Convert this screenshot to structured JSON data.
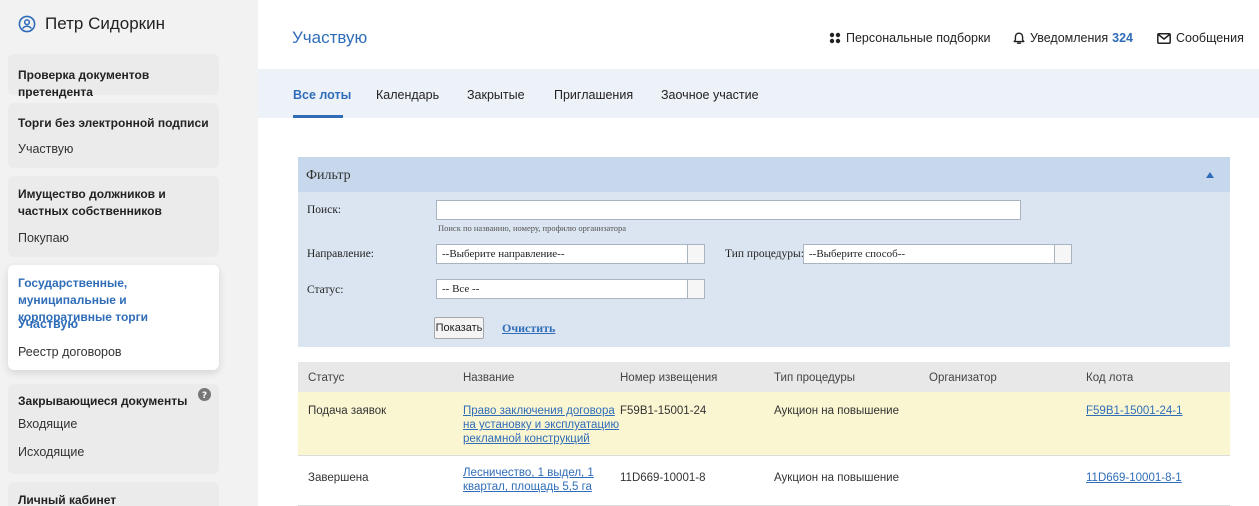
{
  "user": {
    "name": "Петр Сидоркин"
  },
  "sidebar": {
    "sections": [
      {
        "title": "Проверка документов претендента",
        "items": []
      },
      {
        "title": "Торги без электронной подписи",
        "items": [
          "Участвую"
        ]
      },
      {
        "title": "Имущество должников и частных собственников",
        "items": [
          "Покупаю"
        ]
      },
      {
        "title": "Государственные, муниципальные и корпоративные торги",
        "items": [
          "Участвую",
          "Реестр договоров"
        ],
        "active": true,
        "selected_item": "Участвую"
      },
      {
        "title": "Закрывающиеся документы",
        "items": [
          "Входящие",
          "Исходящие"
        ],
        "help_icon": "question-circle-icon"
      },
      {
        "title": "Личный кабинет",
        "items": []
      }
    ]
  },
  "header": {
    "title": "Участвую",
    "links": {
      "personal": "Персональные подборки",
      "notifications": "Уведомления",
      "notifications_count": "324",
      "messages": "Сообщения"
    }
  },
  "tabs": [
    "Все лоты",
    "Календарь",
    "Закрытые",
    "Приглашения",
    "Заочное участие"
  ],
  "active_tab": "Все лоты",
  "filter": {
    "title": "Фильтр",
    "search_label": "Поиск:",
    "search_value": "",
    "search_hint": "Поиск по названию, номеру, профилю организатора",
    "direction_label": "Направление:",
    "direction_value": "--Выберите направление--",
    "procedure_label": "Тип процедуры:",
    "procedure_value": "--Выберите способ--",
    "status_label": "Статус:",
    "status_value": "-- Все --",
    "show_button": "Показать",
    "clear_button": "Очистить"
  },
  "table": {
    "columns": [
      "Статус",
      "Название",
      "Номер извещения",
      "Тип процедуры",
      "Организатор",
      "Код лота"
    ],
    "rows": [
      {
        "status": "Подача заявок",
        "name_lines": [
          "Право заключения договора",
          "на установку и эксплуатацию",
          "рекламной конструкций"
        ],
        "notice": "F59B1-15001-24",
        "procedure": "Аукцион на повышение",
        "organizer": "",
        "lot_code": "F59B1-15001-24-1",
        "highlight": true
      },
      {
        "status": "Завершена",
        "name_lines": [
          "Лесничество, 1 выдел, 1",
          "квартал, площадь 5,5 га"
        ],
        "notice": "11D669-10001-8",
        "procedure": "Аукцион на повышение",
        "organizer": "",
        "lot_code": "11D669-10001-8-1",
        "highlight": false
      }
    ]
  },
  "colors": {
    "accent": "#2f6db8",
    "sidebar_bg": "#f2f2f2",
    "tabbar_bg": "#edf2f8",
    "filter_bg": "#dbe5f1",
    "row_highlight": "#fbf6d2"
  }
}
